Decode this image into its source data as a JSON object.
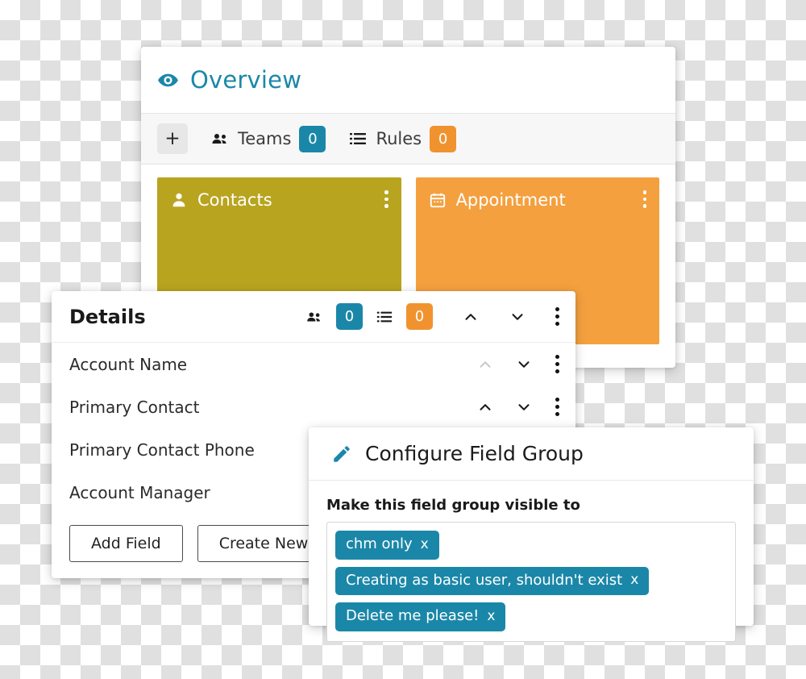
{
  "theme": {
    "accent_teal": "#1b87a8",
    "accent_orange": "#f0932e",
    "tile_contacts": "#b8a41f",
    "tile_appointment": "#f4a03f"
  },
  "overview": {
    "icon": "eye-icon",
    "title": "Overview",
    "toolbar": {
      "add_label": "+",
      "items": [
        {
          "icon": "people-icon",
          "label": "Teams",
          "count": "0",
          "badge_color": "teal"
        },
        {
          "icon": "list-icon",
          "label": "Rules",
          "count": "0",
          "badge_color": "orange"
        }
      ]
    },
    "tiles": [
      {
        "icon": "person-icon",
        "title": "Contacts",
        "menu": "kebab-menu"
      },
      {
        "icon": "calendar-icon",
        "title": "Appointment",
        "menu": "kebab-menu"
      }
    ]
  },
  "details": {
    "title": "Details",
    "header_tools": {
      "people_icon": "people-icon",
      "teams_count": "0",
      "list_icon": "list-icon",
      "rules_count": "0",
      "move_up": "chevron-up-icon",
      "move_down": "chevron-down-icon",
      "menu": "kebab-menu"
    },
    "fields": [
      {
        "label": "Account Name",
        "up_disabled": true
      },
      {
        "label": "Primary Contact",
        "up_disabled": false
      },
      {
        "label": "Primary Contact Phone",
        "up_disabled": false
      },
      {
        "label": "Account Manager",
        "up_disabled": false
      }
    ],
    "buttons": {
      "add_field": "Add Field",
      "create_new_field_group": "Create New Field Group"
    }
  },
  "configure_dialog": {
    "icon": "pencil-icon",
    "title": "Configure Field Group",
    "visible_to_label": "Make this field group visible to",
    "tags": [
      {
        "label": "chm only",
        "remove": "x"
      },
      {
        "label": "Creating as basic user, shouldn't exist",
        "remove": "x"
      },
      {
        "label": "Delete me please!",
        "remove": "x"
      }
    ]
  }
}
